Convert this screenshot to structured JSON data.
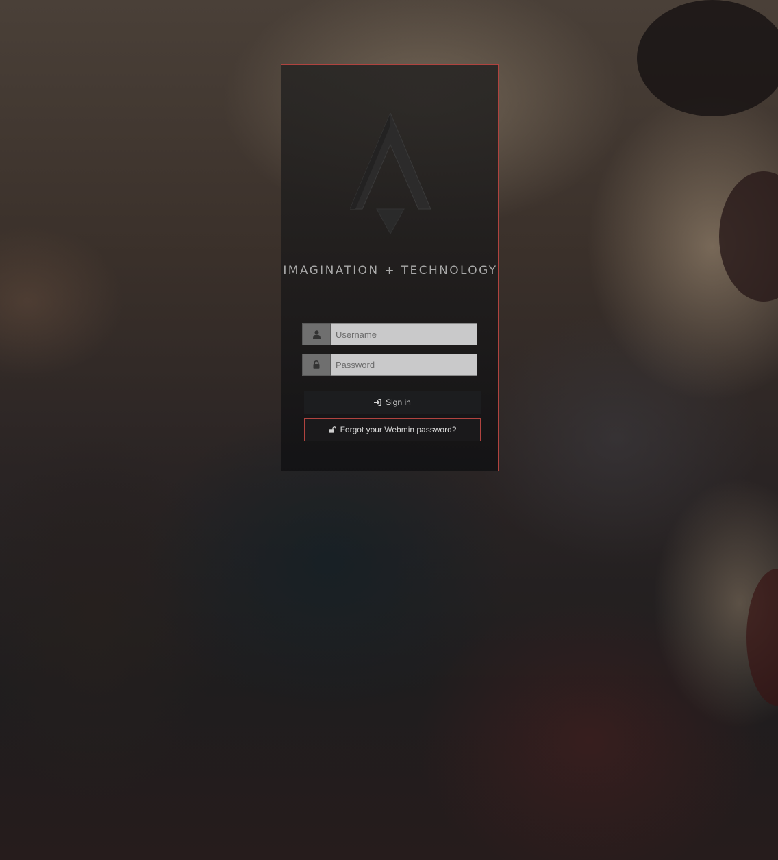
{
  "login": {
    "tagline": "IMAGINATION + TECHNOLOGY",
    "username": {
      "placeholder": "Username",
      "value": "",
      "icon": "user-icon"
    },
    "password": {
      "placeholder": "Password",
      "value": "",
      "icon": "lock-icon"
    },
    "signin_label": "Sign in",
    "signin_icon": "sign-in-icon",
    "forgot_label": "Forgot your Webmin password?",
    "forgot_icon": "unlock-icon",
    "logo": "triangle-arrow-logo"
  },
  "colors": {
    "accent_border": "#b0433f",
    "input_background": "#c9c9ca",
    "addon_background": "#6f6f6f",
    "button_background": "#1c1d1f"
  }
}
